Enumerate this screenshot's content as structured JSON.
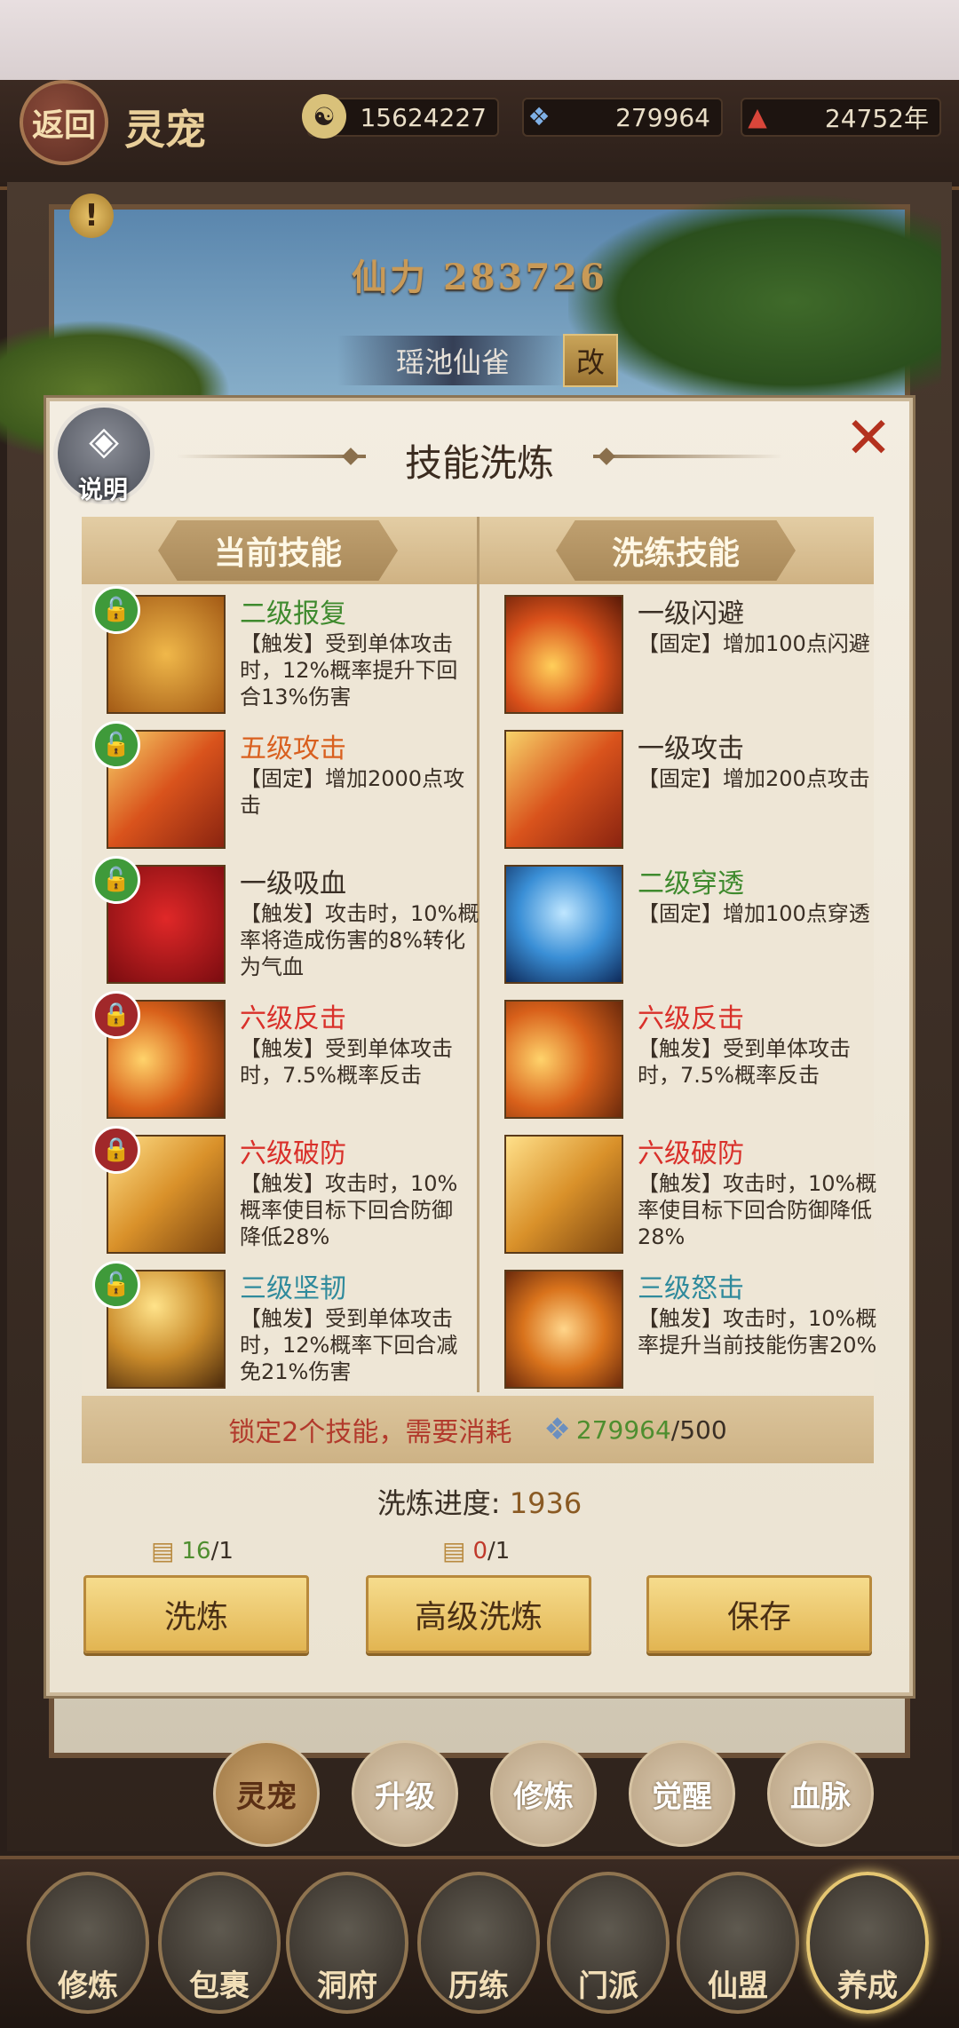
{
  "header": {
    "back_label": "返回",
    "title": "灵宠",
    "resources": [
      {
        "icon": "yin-yang-coin-icon",
        "value": "15624227"
      },
      {
        "icon": "blue-crystal-icon",
        "value": "279964"
      },
      {
        "icon": "red-cultivator-icon",
        "value": "24752年"
      }
    ]
  },
  "pet": {
    "power_label": "仙力 283726",
    "name": "瑶池仙雀",
    "rename_label": "改"
  },
  "modal": {
    "help_label": "说明",
    "title": "技能洗炼",
    "close_icon": "✕",
    "current_header": "当前技能",
    "refine_header": "洗练技能",
    "current_skills": [
      {
        "name": "二级报复",
        "color": "#3f8a2e",
        "lock": "open",
        "desc": "【触发】受到单体攻击时，12%概率提升下回合13%伤害",
        "icon": "tiger-roar-icon"
      },
      {
        "name": "五级攻击",
        "color": "#d9601f",
        "lock": "open",
        "desc": "【固定】增加2000点攻击",
        "icon": "flaming-sword-icon"
      },
      {
        "name": "一级吸血",
        "color": "#3a2f25",
        "lock": "open",
        "desc": "【触发】攻击时，10%概率将造成伤害的8%转化为气血",
        "icon": "blood-drop-icon"
      },
      {
        "name": "六级反击",
        "color": "#d9302a",
        "lock": "closed",
        "desc": "【触发】受到单体攻击时，7.5%概率反击",
        "icon": "counter-strike-icon"
      },
      {
        "name": "六级破防",
        "color": "#d9302a",
        "lock": "closed",
        "desc": "【触发】攻击时，10%概率使目标下回合防御降低28%",
        "icon": "armor-break-icon"
      },
      {
        "name": "三级坚韧",
        "color": "#2f8a9c",
        "lock": "open",
        "desc": "【触发】受到单体攻击时，12%概率下回合减免21%伤害",
        "icon": "warrior-hat-icon"
      }
    ],
    "refine_skills": [
      {
        "name": "一级闪避",
        "color": "#3a2f25",
        "desc": "【固定】增加100点闪避",
        "icon": "dodge-foot-icon"
      },
      {
        "name": "一级攻击",
        "color": "#3a2f25",
        "desc": "【固定】增加200点攻击",
        "icon": "flaming-sword-icon"
      },
      {
        "name": "二级穿透",
        "color": "#3f8a2e",
        "desc": "【固定】增加100点穿透",
        "icon": "piercing-dash-icon"
      },
      {
        "name": "六级反击",
        "color": "#d9302a",
        "desc": "【触发】受到单体攻击时，7.5%概率反击",
        "icon": "counter-strike-icon"
      },
      {
        "name": "六级破防",
        "color": "#d9302a",
        "desc": "【触发】攻击时，10%概率使目标下回合防御降低28%",
        "icon": "armor-break-icon"
      },
      {
        "name": "三级怒击",
        "color": "#2f8a9c",
        "desc": "【触发】攻击时，10%概率提升当前技能伤害20%",
        "icon": "fist-strike-icon"
      }
    ],
    "cost": {
      "text": "锁定2个技能，需要消耗",
      "icon": "blue-crystal-icon",
      "have": "279964",
      "need": "/500"
    },
    "progress": {
      "label": "洗炼进度:",
      "value": "1936"
    },
    "materials": [
      {
        "icon": "scroll-book-icon",
        "have": "16",
        "need": "/1",
        "have_color": "#4e8e2f"
      },
      {
        "icon": "scroll-book-icon",
        "have": "0",
        "need": "/1",
        "have_color": "#c0392b"
      }
    ],
    "buttons": {
      "refine": "洗炼",
      "advanced": "高级洗炼",
      "save": "保存"
    }
  },
  "subtabs": [
    "灵宠",
    "升级",
    "修炼",
    "觉醒",
    "血脉"
  ],
  "bottom_nav": [
    "修炼",
    "包裹",
    "洞府",
    "历练",
    "门派",
    "仙盟",
    "养成"
  ],
  "colors": {
    "accent_gold": "#e2b552",
    "lock_open": "#3f9a3a",
    "lock_closed": "#a1282a"
  }
}
